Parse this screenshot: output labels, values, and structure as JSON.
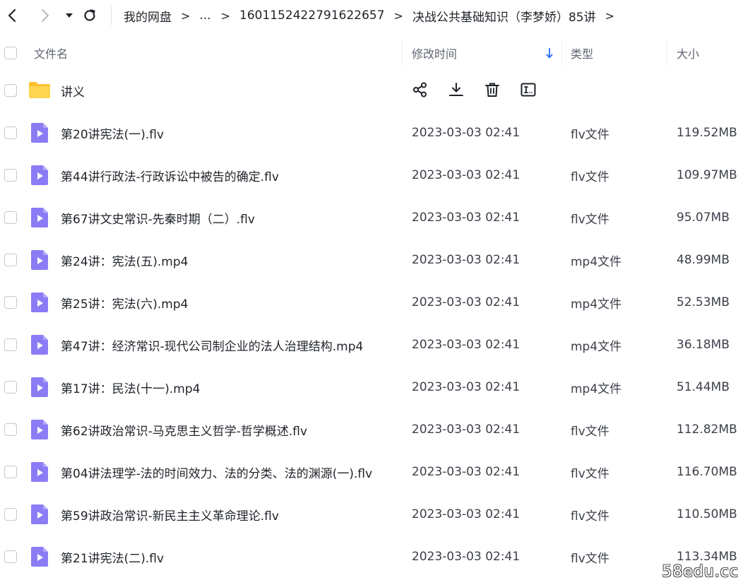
{
  "nav": {
    "back_icon": "chevron-left-icon",
    "forward_icon": "chevron-right-icon",
    "dropdown_icon": "caret-down-icon",
    "refresh_icon": "refresh-icon"
  },
  "breadcrumb": {
    "items": [
      "我的网盘",
      "...",
      "1601152422791622657",
      "决战公共基础知识（李梦娇）85讲"
    ],
    "separator": ">"
  },
  "columns": {
    "name": "文件名",
    "modified": "修改时间",
    "type": "类型",
    "size": "大小",
    "sort_icon": "arrow-down-icon"
  },
  "folder": {
    "name": "讲义",
    "actions": [
      {
        "icon": "share-icon",
        "label": "share"
      },
      {
        "icon": "download-icon",
        "label": "download"
      },
      {
        "icon": "delete-icon",
        "label": "delete"
      },
      {
        "icon": "rename-icon",
        "label": "rename"
      }
    ]
  },
  "files": [
    {
      "name": "第20讲宪法(一).flv",
      "time": "2023-03-03 02:41",
      "type": "flv文件",
      "size": "119.52MB"
    },
    {
      "name": "第44讲行政法-行政诉讼中被告的确定.flv",
      "time": "2023-03-03 02:41",
      "type": "flv文件",
      "size": "109.97MB"
    },
    {
      "name": "第67讲文史常识-先秦时期（二）.flv",
      "time": "2023-03-03 02:41",
      "type": "flv文件",
      "size": "95.07MB"
    },
    {
      "name": "第24讲：宪法(五).mp4",
      "time": "2023-03-03 02:41",
      "type": "mp4文件",
      "size": "48.99MB"
    },
    {
      "name": "第25讲：宪法(六).mp4",
      "time": "2023-03-03 02:41",
      "type": "mp4文件",
      "size": "52.53MB"
    },
    {
      "name": "第47讲：经济常识-现代公司制企业的法人治理结构.mp4",
      "time": "2023-03-03 02:41",
      "type": "mp4文件",
      "size": "36.18MB"
    },
    {
      "name": "第17讲：民法(十一).mp4",
      "time": "2023-03-03 02:41",
      "type": "mp4文件",
      "size": "51.44MB"
    },
    {
      "name": "第62讲政治常识-马克思主义哲学-哲学概述.flv",
      "time": "2023-03-03 02:41",
      "type": "flv文件",
      "size": "112.82MB"
    },
    {
      "name": "第04讲法理学-法的时间效力、法的分类、法的渊源(一).flv",
      "time": "2023-03-03 02:41",
      "type": "flv文件",
      "size": "116.70MB"
    },
    {
      "name": "第59讲政治常识-新民主主义革命理论.flv",
      "time": "2023-03-03 02:41",
      "type": "flv文件",
      "size": "110.50MB"
    },
    {
      "name": "第21讲宪法(二).flv",
      "time": "2023-03-03 02:41",
      "type": "flv文件",
      "size": "113.34MB"
    }
  ],
  "colors": {
    "video_icon": "#8b7cf6",
    "video_icon_fold": "#b3a8fa",
    "folder_icon": "#fbc02d",
    "sort_arrow": "#3478f6"
  },
  "watermark": "58edu.cc"
}
